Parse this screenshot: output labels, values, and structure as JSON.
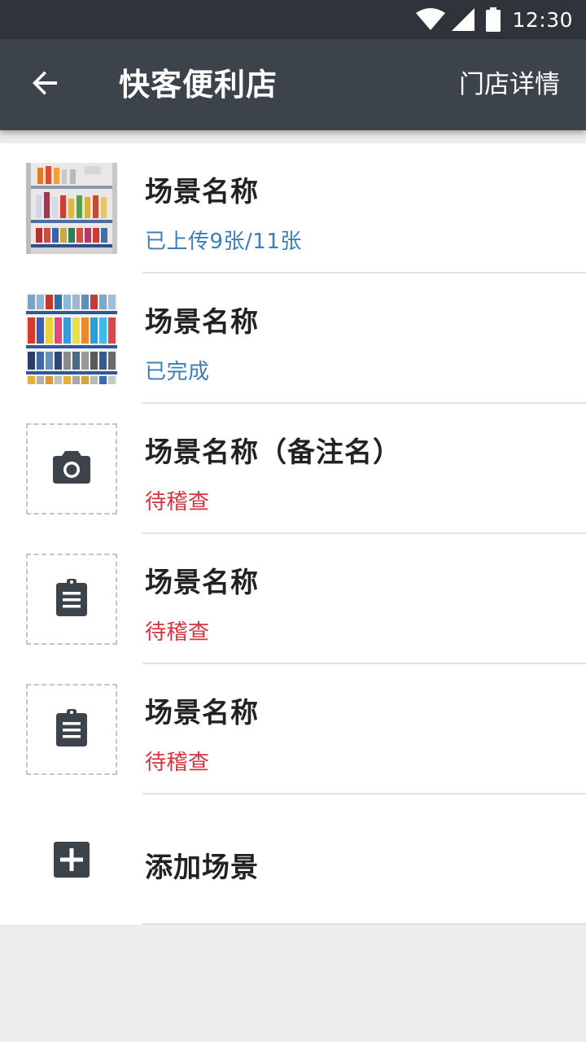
{
  "status_bar": {
    "time": "12:30",
    "icons": [
      "wifi-icon",
      "signal-icon",
      "battery-icon"
    ]
  },
  "app_bar": {
    "back_icon": "arrow-left-icon",
    "title": "快客便利店",
    "action_label": "门店详情"
  },
  "scenes": [
    {
      "name": "场景名称",
      "status": "已上传9张/11张",
      "status_color": "#3a7fb8",
      "thumb": "photo"
    },
    {
      "name": "场景名称",
      "status": "已完成",
      "status_color": "#3a7fb8",
      "thumb": "photo"
    },
    {
      "name": "场景名称（备注名）",
      "status": "待稽查",
      "status_color": "#d6323e",
      "thumb": "camera-icon"
    },
    {
      "name": "场景名称",
      "status": "待稽查",
      "status_color": "#d6323e",
      "thumb": "clipboard-icon"
    },
    {
      "name": "场景名称",
      "status": "待稽查",
      "status_color": "#d6323e",
      "thumb": "clipboard-icon"
    }
  ],
  "add_scene": {
    "label": "添加场景",
    "icon": "add-box-icon"
  },
  "colors": {
    "app_bar": "#3d434b",
    "status_bar": "#2f343a",
    "blue_status": "#3a7fb8",
    "red_status": "#d6323e",
    "background": "#ececec"
  }
}
